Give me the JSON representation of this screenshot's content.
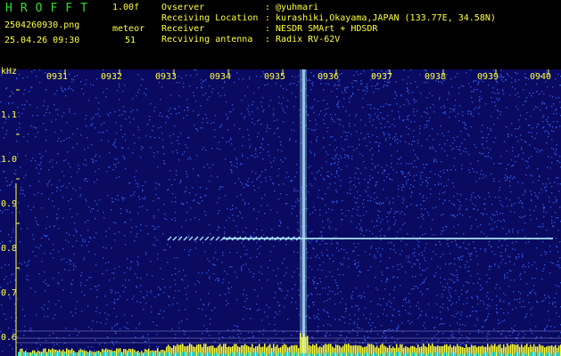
{
  "header": {
    "app_title": "HROFFT",
    "version": "1.00f",
    "filename": "2504260930.png",
    "datetime": "25.04.26 09:30",
    "mode": "meteor",
    "count": "51",
    "info": [
      {
        "label": "Ovserver",
        "value": ": @yuhmari"
      },
      {
        "label": "Receiving Location",
        "value": ": kurashiki,Okayama,JAPAN (133.77E, 34.58N)"
      },
      {
        "label": "Receiver",
        "value": ": NESDR SMArt + HDSDR"
      },
      {
        "label": "Recviving antenna",
        "value": ": Radix RV-62V"
      }
    ]
  },
  "spectrogram": {
    "y_unit": "kHz",
    "y_ticks": [
      "1.1",
      "1.0",
      "0.9",
      "0.8",
      "0.7",
      "0.6"
    ],
    "x_ticks": [
      "0931",
      "0932",
      "0933",
      "0934",
      "0935",
      "0936",
      "0937",
      "0938",
      "0939",
      "0940"
    ],
    "colors": {
      "background": "#0a0a60",
      "noise": "#3a6cff",
      "signal": "#aee8ff",
      "bars": "#ffff30",
      "labels": "#ffff3c",
      "title": "#2fdc2f"
    }
  }
}
